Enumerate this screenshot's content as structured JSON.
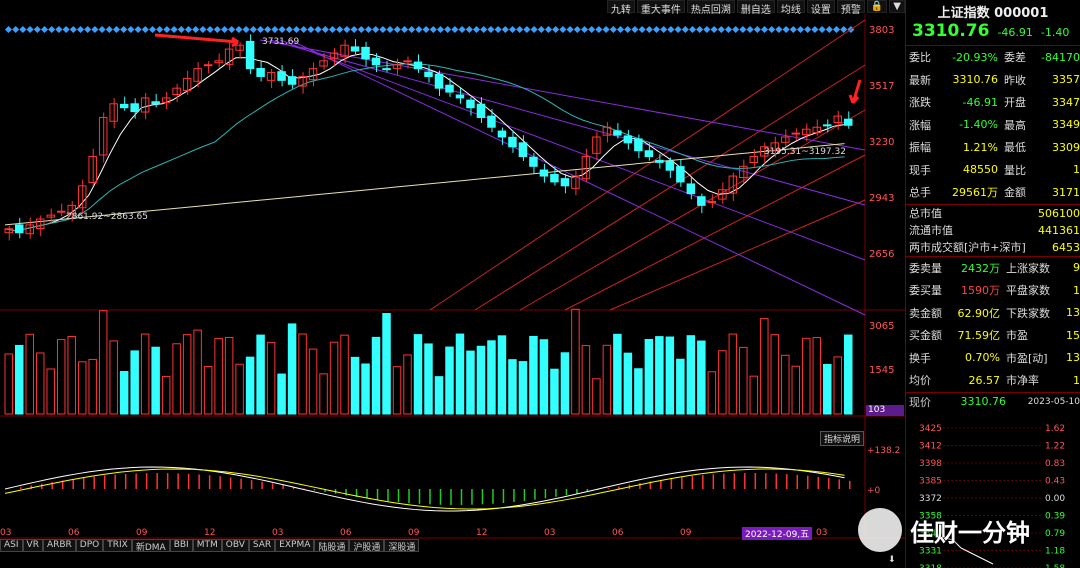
{
  "toolbar": {
    "items": [
      "九转",
      "重大事件",
      "热点回溯",
      "删自选",
      "均线",
      "设置",
      "预警"
    ]
  },
  "quote": {
    "title": "上证指数 000001",
    "price": "3310.76",
    "change": "-46.91",
    "change_pct": "-1.40",
    "rows": [
      [
        "委比",
        "-20.93%",
        "委差",
        "-84170"
      ],
      [
        "最新",
        "3310.76",
        "昨收",
        "3357"
      ],
      [
        "涨跌",
        "-46.91",
        "开盘",
        "3347"
      ],
      [
        "涨幅",
        "-1.40%",
        "最高",
        "3349"
      ],
      [
        "振幅",
        "1.21%",
        "最低",
        "3309"
      ],
      [
        "现手",
        "48550",
        "量比",
        "1"
      ],
      [
        "总手",
        "29561万",
        "金额",
        "3171"
      ]
    ],
    "wide": [
      [
        "总市值",
        "506100"
      ],
      [
        "流通市值",
        "441361"
      ],
      [
        "两市成交额[沪市+深市]",
        "6453"
      ]
    ],
    "detail": [
      [
        "委卖量",
        "2432万",
        "上涨家数",
        "9"
      ],
      [
        "委买量",
        "1590万",
        "平盘家数",
        "1"
      ],
      [
        "卖金额",
        "62.90亿",
        "下跌家数",
        "13"
      ],
      [
        "买金额",
        "71.59亿",
        "市盈",
        "15"
      ],
      [
        "换手",
        "0.70%",
        "市盈[动]",
        "13"
      ],
      [
        "均价",
        "26.57",
        "市净率",
        "1"
      ]
    ],
    "tick_header": [
      "现价",
      "3310.76",
      "2023-05-10"
    ]
  },
  "axis": {
    "price_ticks": [
      "3803",
      "3517",
      "3230",
      "2943",
      "2656"
    ],
    "vol_ticks": [
      "3065",
      "1545"
    ],
    "vol_badge": "103",
    "macd_ticks": [
      "+138.2",
      "+0"
    ],
    "months": [
      "03",
      "06",
      "09",
      "12",
      "03",
      "06",
      "09",
      "12",
      "03",
      "06",
      "09",
      "12",
      "03"
    ]
  },
  "annotations": {
    "high": "3731.69",
    "low": "2861.92~2863.65",
    "mid": "3195.31~3197.32",
    "date_badge": "2022-12-09,五",
    "info_button": "指标说明"
  },
  "mini": {
    "ticks_left": [
      "3425",
      "3412",
      "3398",
      "3385",
      "3372",
      "3358",
      "3345",
      "3331",
      "3318"
    ],
    "ticks_right": [
      "1.62",
      "1.22",
      "0.83",
      "0.43",
      "0.00",
      "0.39",
      "0.79",
      "1.18",
      "1.58"
    ]
  },
  "bottom_tabs": [
    "ASI",
    "VR",
    "ARBR",
    "DPO",
    "TRIX",
    "新DMA",
    "BBI",
    "MTM",
    "OBV",
    "SAR",
    "EXPMA",
    "陆股通",
    "沪股通",
    "深股通"
  ],
  "watermark": "佳财一分钟",
  "colors": {
    "up": "#ff3333",
    "down": "#33ffff",
    "ma_white": "#ffffff",
    "ma_yellow": "#ffff00",
    "channel_red": "#cc2222",
    "channel_purple": "#8a2be2"
  },
  "chart_data": {
    "type": "candlestick",
    "series_close": [
      2780,
      2760,
      2800,
      2830,
      2850,
      2870,
      2900,
      3000,
      3150,
      3350,
      3420,
      3400,
      3380,
      3450,
      3420,
      3450,
      3500,
      3550,
      3600,
      3620,
      3640,
      3700,
      3720,
      3600,
      3560,
      3580,
      3540,
      3520,
      3560,
      3600,
      3640,
      3680,
      3720,
      3690,
      3650,
      3620,
      3600,
      3620,
      3640,
      3600,
      3560,
      3500,
      3480,
      3450,
      3400,
      3350,
      3300,
      3250,
      3200,
      3150,
      3100,
      3050,
      3020,
      3000,
      3050,
      3150,
      3250,
      3300,
      3260,
      3220,
      3180,
      3150,
      3120,
      3080,
      3020,
      2960,
      2900,
      2920,
      2980,
      3050,
      3100,
      3150,
      3200,
      3220,
      3250,
      3270,
      3290,
      3300,
      3310,
      3357,
      3310
    ]
  }
}
